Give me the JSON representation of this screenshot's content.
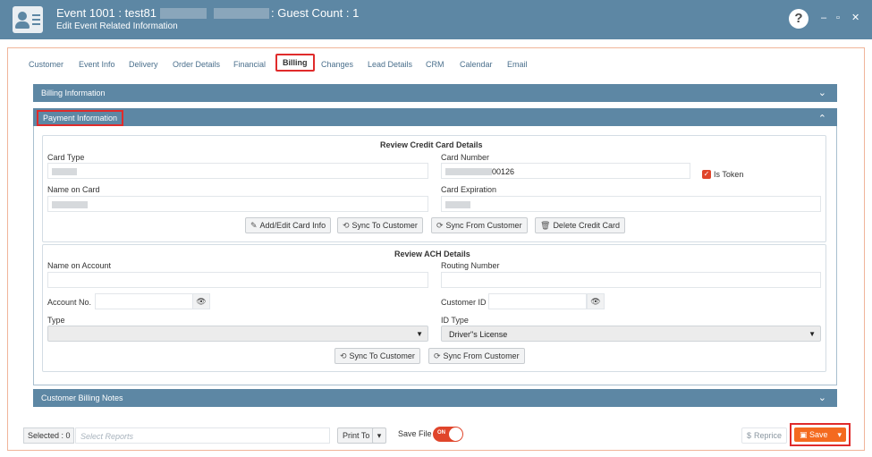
{
  "titlebar": {
    "title_prefix": "Event 1001 : test81",
    "title_suffix": ": Guest Count : 1",
    "subtitle": "Edit Event Related Information",
    "help": "?",
    "minimize": "–",
    "maximize": "▫",
    "close": "✕"
  },
  "tabs": [
    "Customer",
    "Event Info",
    "Delivery",
    "Order Details",
    "Financial",
    "Billing",
    "Changes",
    "Lead Details",
    "CRM",
    "Calendar",
    "Email"
  ],
  "active_tab": "Billing",
  "sections": {
    "billing_info": "Billing Information",
    "payment_info": "Payment Information",
    "customer_notes": "Customer Billing Notes"
  },
  "credit_card": {
    "heading": "Review Credit Card Details",
    "card_type_label": "Card Type",
    "card_number_label": "Card Number",
    "card_number_suffix": "00126",
    "is_token_label": "Is Token",
    "name_on_card_label": "Name on Card",
    "card_expiration_label": "Card Expiration",
    "buttons": {
      "add_edit": "Add/Edit Card Info",
      "sync_to": "Sync To Customer",
      "sync_from": "Sync From Customer",
      "delete": "Delete Credit Card"
    }
  },
  "ach": {
    "heading": "Review ACH Details",
    "name_on_account_label": "Name on Account",
    "routing_number_label": "Routing Number",
    "account_no_label": "Account No.",
    "customer_id_label": "Customer ID",
    "type_label": "Type",
    "id_type_label": "ID Type",
    "id_type_value": "Driver\"s License",
    "buttons": {
      "sync_to": "Sync To Customer",
      "sync_from": "Sync From Customer"
    }
  },
  "footer": {
    "selected": "Selected : 0",
    "reports_placeholder": "Select Reports",
    "print_to": "Print To",
    "save_file": "Save File",
    "toggle": "ON",
    "reprice": "Reprice",
    "save": "Save"
  },
  "colors": {
    "header": "#5d87a4",
    "accent": "#e0452b",
    "save": "#f46a1f",
    "highlight": "#e02b2b"
  }
}
